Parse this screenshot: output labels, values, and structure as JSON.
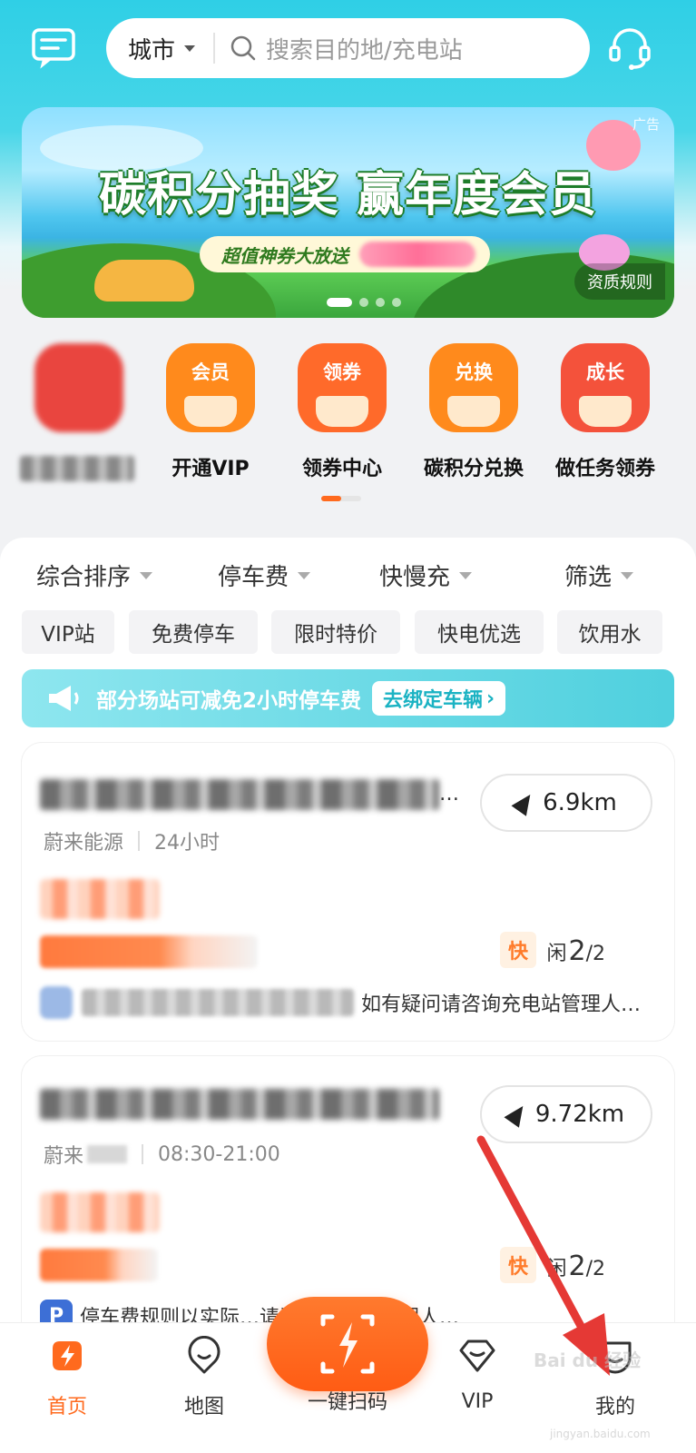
{
  "header": {
    "city_label": "城市",
    "search_placeholder": "搜索目的地/充电站"
  },
  "banner": {
    "ad_tag": "广告",
    "title": "碳积分抽奖 赢年度会员",
    "subtitle": "超值神券大放送",
    "rules_label": "资质规则"
  },
  "quick_actions": [
    {
      "tag": "",
      "label": "",
      "color": "#e9453f"
    },
    {
      "tag": "会员",
      "label": "开通VIP",
      "color": "#ff8a1c"
    },
    {
      "tag": "领券",
      "label": "领券中心",
      "color": "#ff6a2a"
    },
    {
      "tag": "兑换",
      "label": "碳积分兑换",
      "color": "#ff8a1c"
    },
    {
      "tag": "成长",
      "label": "做任务领券",
      "color": "#f4523b"
    }
  ],
  "filters": {
    "sort": "综合排序",
    "parking": "停车费",
    "speed": "快慢充",
    "filter": "筛选"
  },
  "chips": [
    "VIP站",
    "免费停车",
    "限时特价",
    "快电优选",
    "饮用水"
  ],
  "promo": {
    "text": "部分场站可减免2小时停车费",
    "button": "去绑定车辆"
  },
  "stations": [
    {
      "name_ellipsis": "…",
      "distance": "6.9km",
      "operator": "蔚来能源",
      "hours": "24小时",
      "speed_tag": "快",
      "idle_prefix": "闲",
      "idle_count": "2",
      "total": "/2",
      "note": "如有疑问请咨询充电站管理人…"
    },
    {
      "distance": "9.72km",
      "operator": "蔚来",
      "hours": "08:30-21:00",
      "speed_tag": "快",
      "idle_prefix": "闲",
      "idle_count": "2",
      "total": "/2",
      "note": "停车费规则以实际…请咨询充电站管理人…",
      "note_icon": "P"
    }
  ],
  "tabbar": {
    "home": "首页",
    "map": "地图",
    "scan": "一键扫码",
    "vip": "VIP",
    "mine": "我的"
  },
  "watermark": {
    "main": "Bai du 经验",
    "sub": "jingyan.baidu.com"
  },
  "colors": {
    "accent": "#ff6a1e",
    "teal": "#2fcfe6"
  }
}
